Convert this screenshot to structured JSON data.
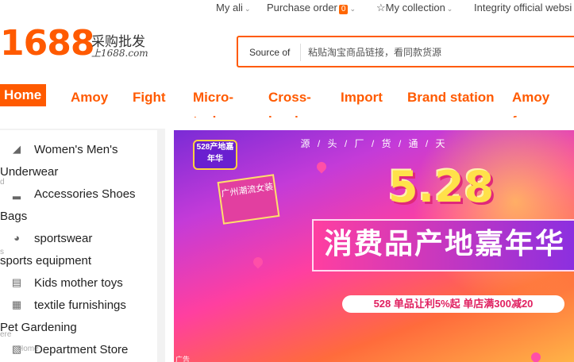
{
  "topbar": {
    "my_ali": "My ali",
    "purchase_order": "Purchase order",
    "purchase_badge": "0",
    "my_collection": "My collection",
    "integrity": "Integrity official websi"
  },
  "logo": {
    "number": "1688",
    "chinese": "采购批发",
    "domain": "上1688.com"
  },
  "search": {
    "source_label": "Source of",
    "placeholder": "粘贴淘宝商品链接，看同款货源"
  },
  "nav": {
    "home": "Home",
    "items": [
      "Amoy",
      "Fight",
      "Micro-tech",
      "Cross-border",
      "Import",
      "Brand station",
      "Amoy fac"
    ]
  },
  "categories": [
    {
      "icon": "dress-icon",
      "line1": "Women's Men's",
      "line2": "Underwear"
    },
    {
      "icon": "boot-icon",
      "line1": "Accessories Shoes",
      "line2": "Bags"
    },
    {
      "icon": "helmet-icon",
      "line1": "sportswear",
      "line2": "sports equipment"
    },
    {
      "icon": "toy-icon",
      "line1": "Kids mother toys",
      "line2": ""
    },
    {
      "icon": "fabric-icon",
      "line1": "textile furnishings",
      "line2": "Pet Gardening"
    },
    {
      "icon": "store-icon",
      "line1": "Department Store",
      "line2": ""
    }
  ],
  "ghost_labels": [
    "d",
    "s",
    "ere",
    "Home"
  ],
  "banner": {
    "tag": "528产地嘉年华",
    "headline": "源 / 头 / 厂 / 货 / 通 / 天",
    "box_text": "广州潮流女装",
    "big": "5.28",
    "slogan": "消费品产地嘉年华",
    "promo": "528 单品让利5%起  单店满300减20",
    "bottom": "广告"
  },
  "colors": {
    "accent": "#ff5a00",
    "text": "#333333"
  }
}
